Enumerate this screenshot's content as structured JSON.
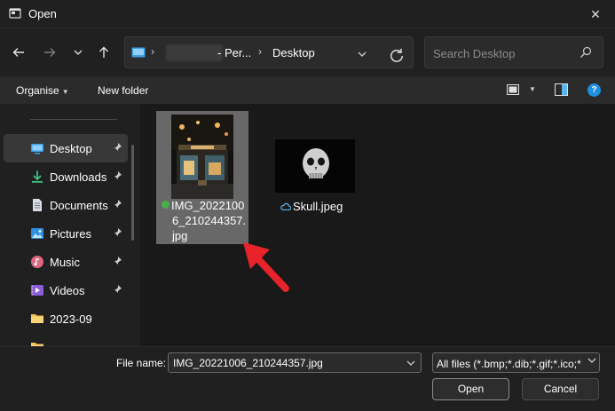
{
  "window": {
    "title": "Open"
  },
  "address": {
    "segment_person": "- Per...",
    "segment_current": "Desktop"
  },
  "search": {
    "placeholder": "Search Desktop"
  },
  "toolbar": {
    "organise_label": "Organise",
    "new_folder_label": "New folder"
  },
  "sidebar": {
    "items": [
      {
        "label": "Desktop",
        "icon": "desktop-icon",
        "pinned": true,
        "selected": true
      },
      {
        "label": "Downloads",
        "icon": "download-icon",
        "pinned": true
      },
      {
        "label": "Documents",
        "icon": "document-icon",
        "pinned": true
      },
      {
        "label": "Pictures",
        "icon": "pictures-icon",
        "pinned": true
      },
      {
        "label": "Music",
        "icon": "music-icon",
        "pinned": true
      },
      {
        "label": "Videos",
        "icon": "videos-icon",
        "pinned": true
      },
      {
        "label": "2023-09",
        "icon": "folder-icon",
        "pinned": false
      }
    ]
  },
  "files": [
    {
      "name_line1": "IMG_2022100",
      "name_line2": "6_210244357.",
      "name_line3": "jpg",
      "status": "synced",
      "selected": true
    },
    {
      "name": "Skull.jpeg",
      "status": "cloud",
      "selected": false
    }
  ],
  "bottom": {
    "file_name_label": "File name:",
    "file_name_value": "IMG_20221006_210244357.jpg",
    "filter_value": "All files (*.bmp;*.dib;*.gif;*.ico;*",
    "open_label": "Open",
    "cancel_label": "Cancel"
  },
  "colors": {
    "background": "#202020",
    "content": "#191919",
    "selection": "#686868",
    "accent": "#1d8fe0",
    "annotation_arrow": "#e8242a"
  }
}
